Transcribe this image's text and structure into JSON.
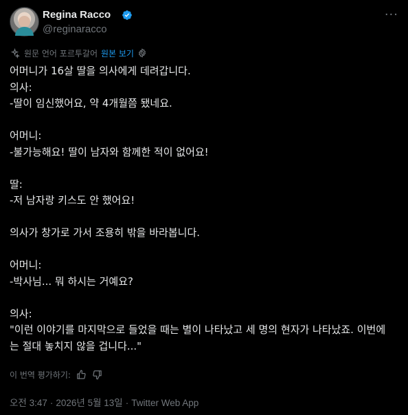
{
  "author": {
    "name": "Regina Racco",
    "handle": "@reginaracco",
    "verified": true
  },
  "header": {
    "more_icon": "more-horizontal-icon"
  },
  "translation": {
    "source_label": "원문 언어 포르투갈어",
    "show_original_label": "원본 보기",
    "settings_icon": "gear-icon",
    "translate_icon": "translate-icon"
  },
  "tweet": {
    "text": "어머니가 16살 딸을 의사에게 데려갑니다.\n의사:\n-딸이 임신했어요, 약 4개월쯤 됐네요.\n\n어머니:\n-불가능해요! 딸이 남자와 함께한 적이 없어요!\n\n딸:\n-저 남자랑 키스도 안 했어요!\n\n의사가 창가로 가서 조용히 밖을 바라봅니다.\n\n어머니:\n-박사님... 뭐 하시는 거예요?\n\n의사:\n\"이런 이야기를 마지막으로 들었을 때는 별이 나타났고 세 명의 현자가 나타났죠. 이번에는 절대 놓치지 않을 겁니다...\""
  },
  "rating": {
    "label": "이 번역 평가하기:",
    "like_icon": "thumbs-up-icon",
    "dislike_icon": "thumbs-down-icon"
  },
  "meta": {
    "time": "오전 3:47",
    "date": "2026년 5월 13일",
    "source": "Twitter Web App",
    "separator": "·"
  },
  "colors": {
    "background": "#000000",
    "text": "#e7e9ea",
    "secondary": "#71767b",
    "accent": "#1d9bf0"
  }
}
